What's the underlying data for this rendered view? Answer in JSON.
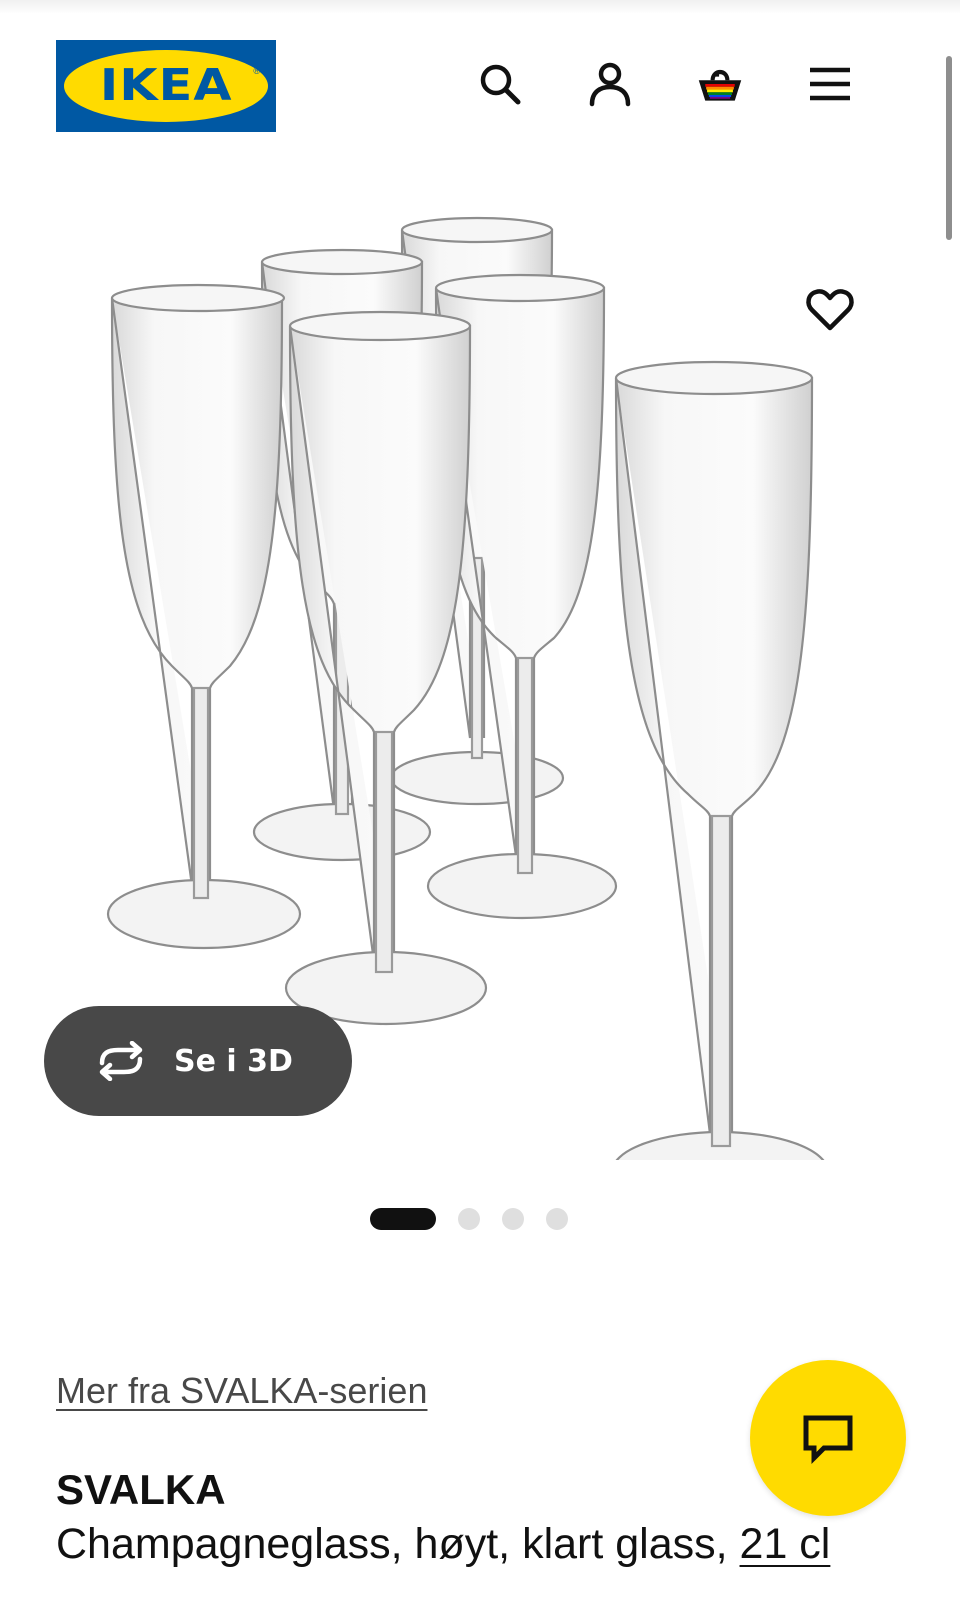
{
  "header": {
    "logo_text": "IKEA",
    "logo_reg": "®",
    "icons": [
      "search-icon",
      "account-icon",
      "shopping-basket-icon",
      "menu-icon"
    ]
  },
  "gallery": {
    "favorite_icon": "heart-icon",
    "view_3d_label": "Se i 3D",
    "view_3d_icon": "rotate-3d-icon",
    "carousel": {
      "total": 4,
      "active_index": 0
    }
  },
  "product": {
    "series_link": "Mer fra SVALKA-serien",
    "name": "SVALKA",
    "description": "Champagneglass, høyt, klart glass, ",
    "size": "21 cl"
  },
  "chat": {
    "icon": "chat-icon"
  },
  "colors": {
    "ikea_blue": "#0058a3",
    "ikea_yellow": "#ffdb00",
    "button_dark": "#484848",
    "text": "#111111"
  }
}
